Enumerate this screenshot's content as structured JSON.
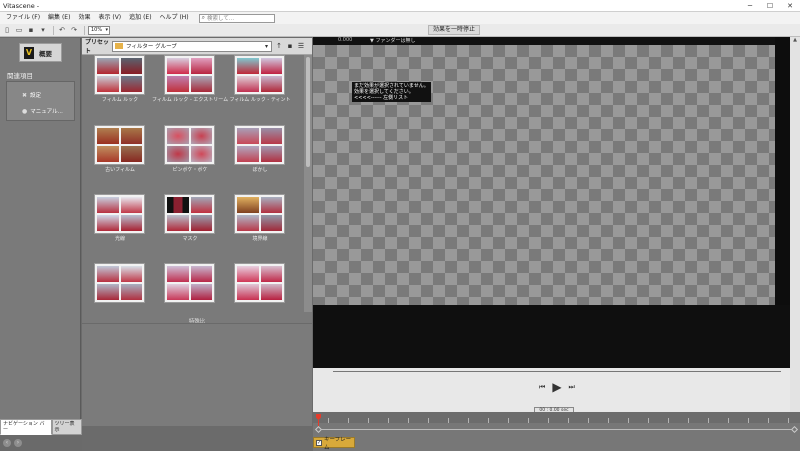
{
  "window": {
    "title": "Vitascene -"
  },
  "menu": {
    "items": [
      "ファイル (F)",
      "編集 (E)",
      "効果",
      "表示 (V)",
      "追加 (E)",
      "ヘルプ (H)"
    ],
    "search_placeholder": "検索して..."
  },
  "toolbar": {
    "zoom": "10%",
    "pause_effect": "効果を一時停止"
  },
  "nav": {
    "summary_label": "概要",
    "logo_letter": "V",
    "related_header": "関連項目",
    "related_items": [
      "設定",
      "マニュアル..."
    ],
    "tabs": [
      "ナビゲーション バー",
      "ツリー表示"
    ]
  },
  "preset": {
    "label": "プリセット",
    "group": "フィルター グループ",
    "items": [
      {
        "caption": "フィルム ルック"
      },
      {
        "caption": "フィルム ルック - エクストリーム"
      },
      {
        "caption": "フィルム ルック - ティント"
      },
      {
        "caption": "古いフィルム"
      },
      {
        "caption": "ピンボケ・ボケ"
      },
      {
        "caption": "ぼかし"
      },
      {
        "caption": "光線"
      },
      {
        "caption": "マスク"
      },
      {
        "caption": "境界線"
      },
      {
        "caption": ""
      },
      {
        "caption": ""
      },
      {
        "caption": ""
      }
    ],
    "special_label": "特殊比"
  },
  "viewer": {
    "time": "0.000",
    "marker_label": "ファンダーは無し",
    "notice_text": "まだ効果が選択されていません。\n効果を選択してください。\n<<<<------ 左側リスト"
  },
  "playback": {
    "timecode": "00 : 0.00 sec"
  },
  "timeline": {
    "keyframe_label": "キーフレーム",
    "keyframe_checked": true
  },
  "colors": {
    "accent_keyframe": "#d8a93a",
    "playhead": "#e53b2b",
    "logo_yellow": "#e8c020"
  }
}
